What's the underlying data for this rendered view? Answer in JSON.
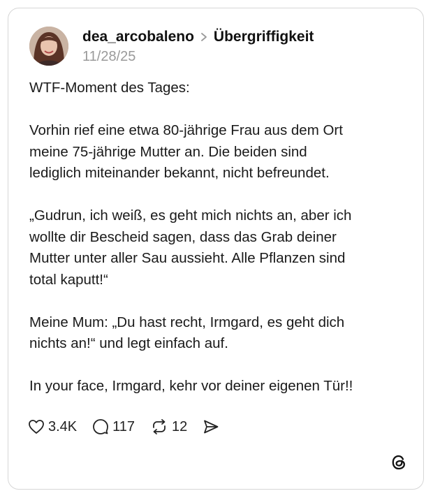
{
  "post": {
    "username": "dea_arcobaleno",
    "topic": "Übergriffigkeit",
    "date": "11/28/25",
    "paragraphs": [
      "WTF-Moment des Tages:",
      "Vorhin rief eine etwa 80-jährige Frau aus dem Ort\nmeine 75-jährige Mutter an. Die beiden sind\nlediglich miteinander bekannt, nicht befreundet.",
      "„Gudrun, ich weiß, es geht mich nichts an, aber ich\nwollte dir Bescheid sagen, dass das Grab deiner\nMutter unter aller Sau aussieht. Alle Pflanzen sind\ntotal kaputt!“",
      "Meine Mum: „Du hast recht, Irmgard, es geht dich\nnichts an!“ und legt einfach auf.",
      "In your face, Irmgard, kehr vor deiner eigenen Tür!!"
    ]
  },
  "actions": {
    "likes": "3.4K",
    "replies": "117",
    "reposts": "12"
  },
  "icons": {
    "like": "heart-icon",
    "reply": "comment-bubble-icon",
    "repost": "repost-arrows-icon",
    "share": "send-arrow-icon",
    "brand": "threads-logo-icon"
  },
  "colors": {
    "text": "#111111",
    "muted": "#9a9a9a",
    "border": "#d6d6d6"
  }
}
